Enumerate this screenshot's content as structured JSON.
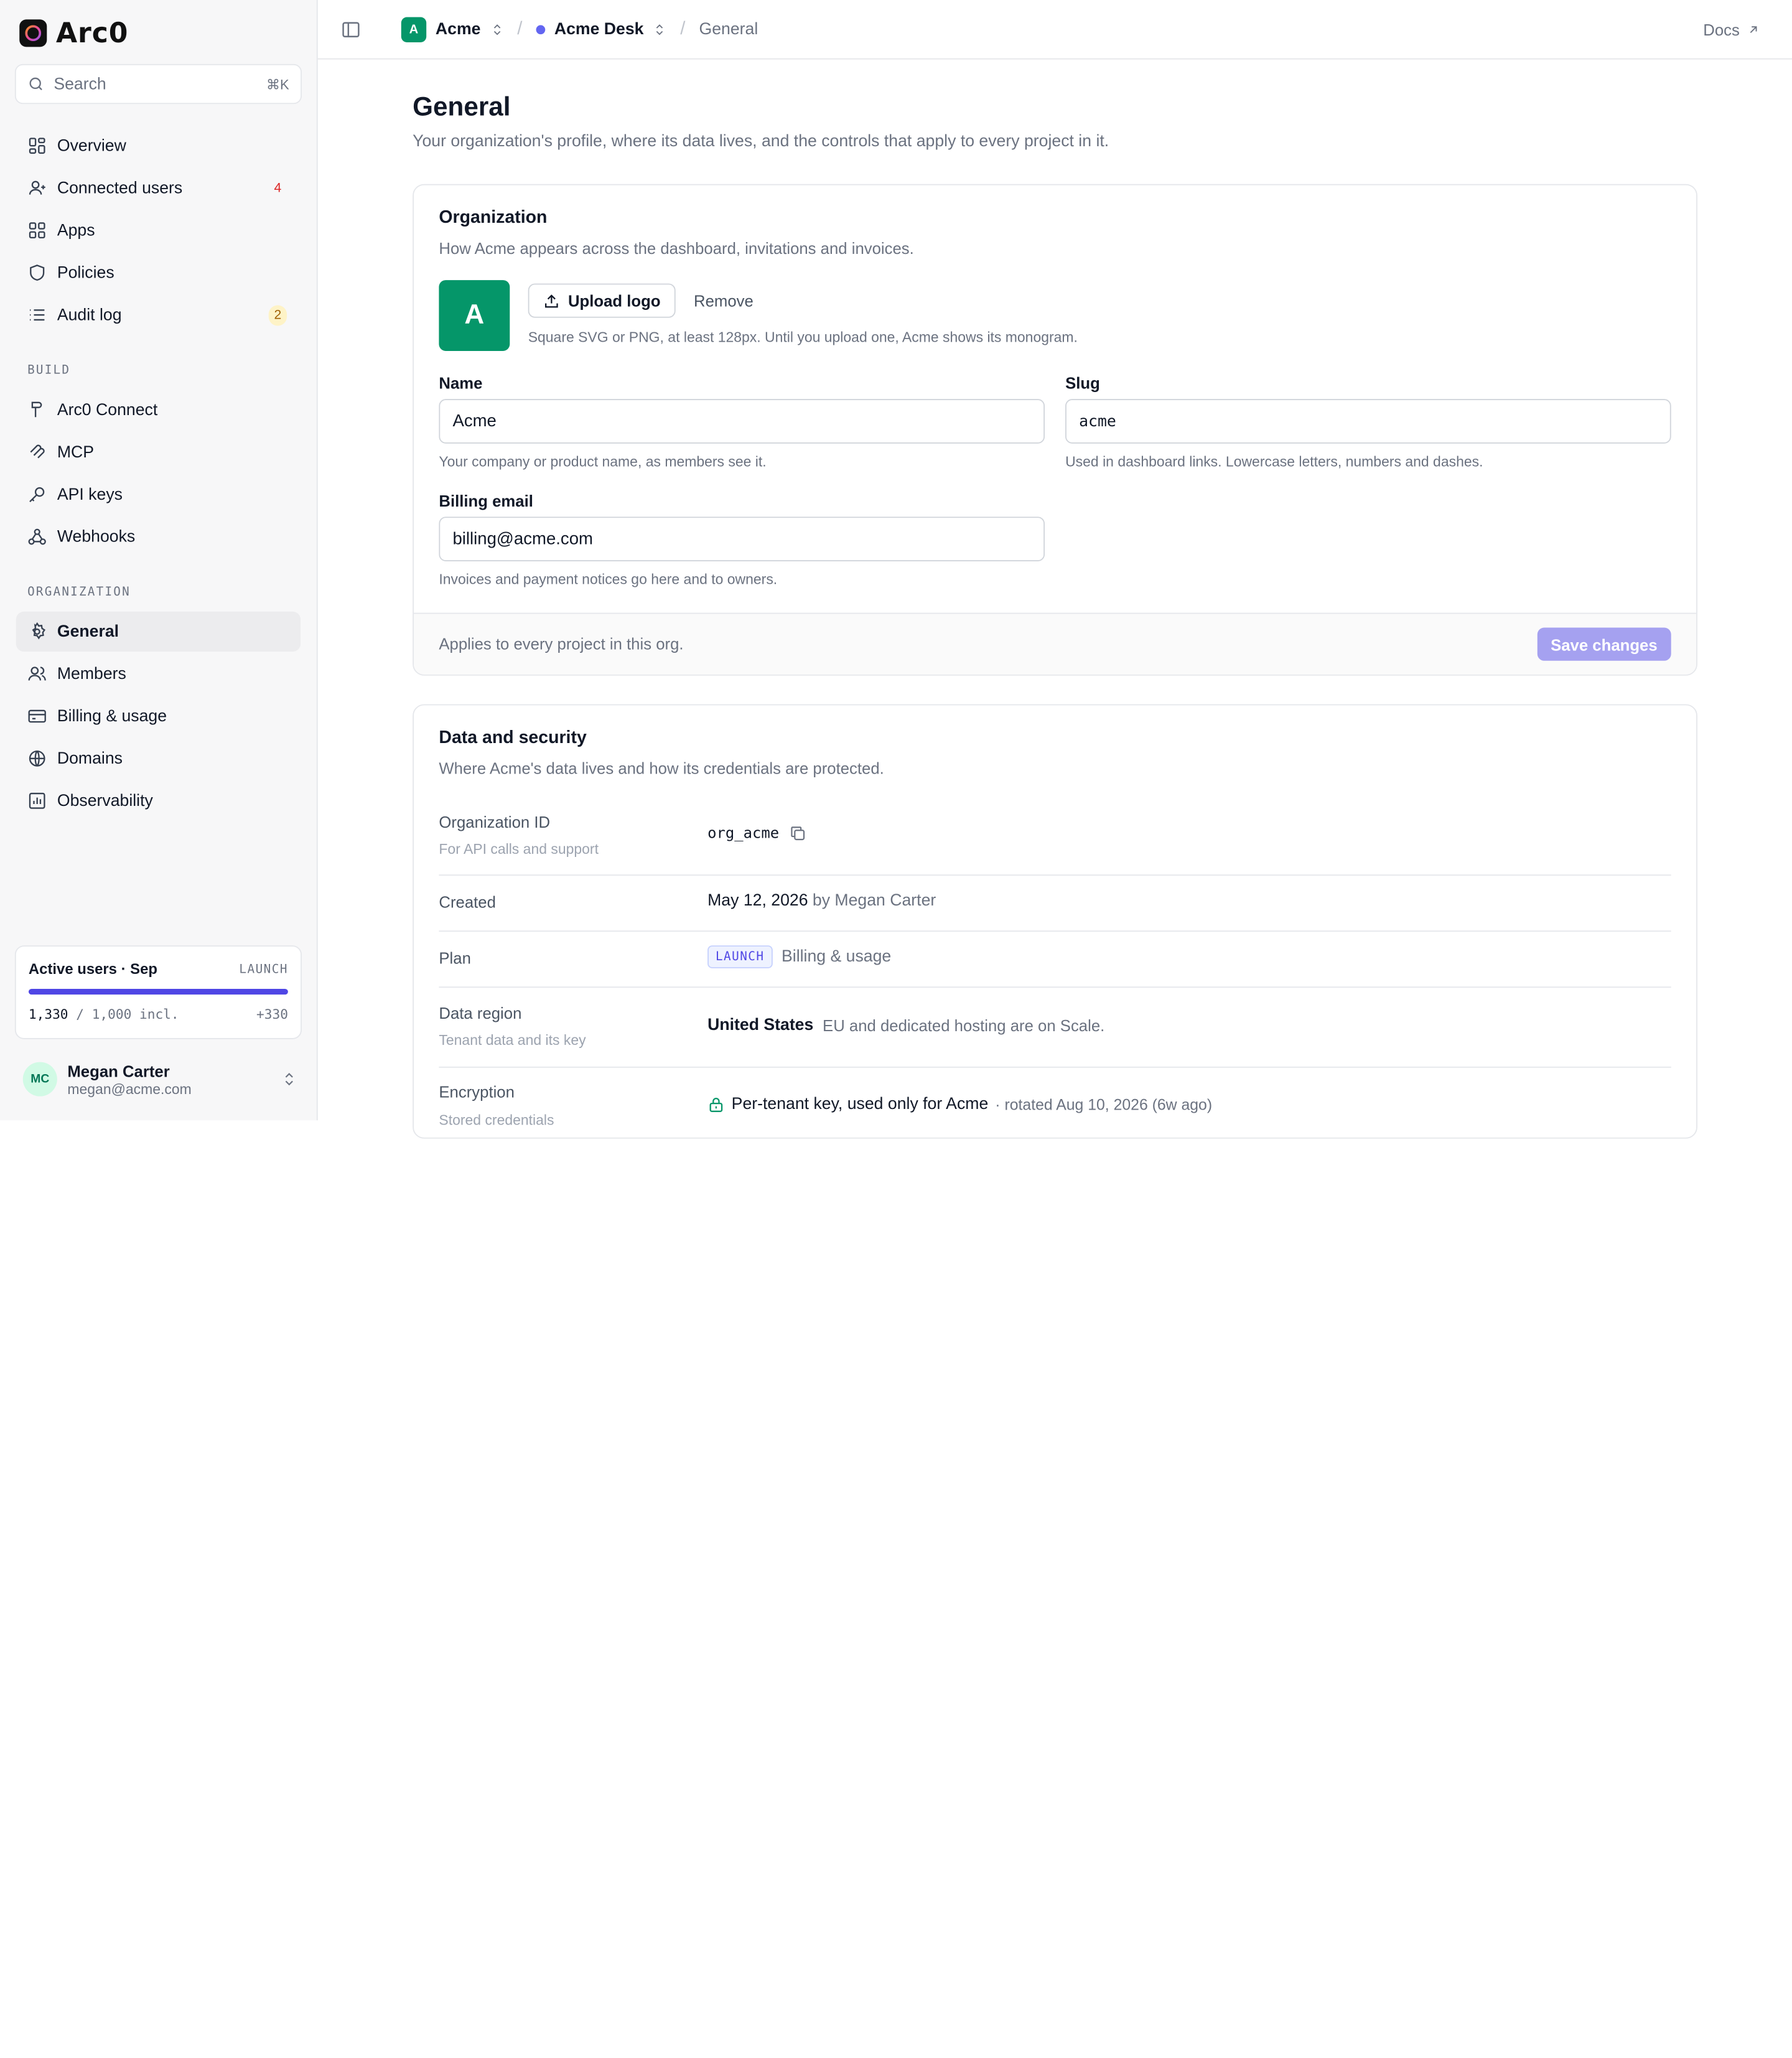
{
  "brand": {
    "name": "Arc0"
  },
  "search": {
    "label": "Search",
    "shortcut": "⌘K"
  },
  "nav": {
    "main": [
      {
        "label": "Overview",
        "icon": "grid-icon"
      },
      {
        "label": "Connected users",
        "icon": "users-icon",
        "badge": "4"
      },
      {
        "label": "Apps",
        "icon": "apps-icon"
      },
      {
        "label": "Policies",
        "icon": "shield-icon"
      },
      {
        "label": "Audit log",
        "icon": "list-icon",
        "badge": "2"
      }
    ],
    "build_label": "BUILD",
    "build": [
      {
        "label": "Arc0 Connect",
        "icon": "plug-icon"
      },
      {
        "label": "MCP",
        "icon": "mcp-icon"
      },
      {
        "label": "API keys",
        "icon": "key-icon"
      },
      {
        "label": "Webhooks",
        "icon": "webhook-icon"
      }
    ],
    "org_label": "ORGANIZATION",
    "org": [
      {
        "label": "General",
        "icon": "gear-icon",
        "active": true
      },
      {
        "label": "Members",
        "icon": "members-icon"
      },
      {
        "label": "Billing & usage",
        "icon": "card-icon"
      },
      {
        "label": "Domains",
        "icon": "globe-icon"
      },
      {
        "label": "Observability",
        "icon": "chart-icon"
      }
    ]
  },
  "usage": {
    "title": "Active users · Sep",
    "plan": "LAUNCH",
    "used": "1,330",
    "included": "/ 1,000 incl.",
    "overage": "+330",
    "fill_fraction": 1.0
  },
  "user": {
    "initials": "MC",
    "name": "Megan Carter",
    "email": "megan@acme.com"
  },
  "topbar": {
    "org_initial": "A",
    "org": "Acme",
    "project": "Acme Desk",
    "page": "General",
    "docs": "Docs"
  },
  "page": {
    "title": "General",
    "subtitle": "Your organization's profile, where its data lives, and the controls that apply to every project in it."
  },
  "org_card": {
    "title": "Organization",
    "subtitle": "How Acme appears across the dashboard, invitations and invoices.",
    "logo_initial": "A",
    "upload_label": "Upload logo",
    "remove_label": "Remove",
    "logo_hint": "Square SVG or PNG, at least 128px. Until you upload one, Acme shows its monogram.",
    "name_label": "Name",
    "name_value": "Acme",
    "name_hint": "Your company or product name, as members see it.",
    "slug_label": "Slug",
    "slug_value": "acme",
    "slug_hint": "Used in dashboard links. Lowercase letters, numbers and dashes.",
    "email_label": "Billing email",
    "email_value": "billing@acme.com",
    "email_hint": "Invoices and payment notices go here and to owners.",
    "footer_text": "Applies to every project in this org.",
    "save_label": "Save changes"
  },
  "security_card": {
    "title": "Data and security",
    "subtitle": "Where Acme's data lives and how its credentials are protected.",
    "org_id_label": "Organization ID",
    "org_id_sub": "For API calls and support",
    "org_id_value": "org_acme",
    "created_label": "Created",
    "created_date": "May 12, 2026",
    "created_by": "by Megan Carter",
    "plan_label": "Plan",
    "plan_value": "LAUNCH",
    "plan_link": "Billing & usage",
    "region_label": "Data region",
    "region_sub": "Tenant data and its key",
    "region_value": "United States",
    "region_note": "EU and dedicated hosting are on Scale.",
    "encryption_label": "Encryption",
    "encryption_sub": "Stored credentials",
    "encryption_value": "Per-tenant key, used only for Acme",
    "encryption_note": "· rotated Aug 10, 2026 (6w ago)"
  }
}
